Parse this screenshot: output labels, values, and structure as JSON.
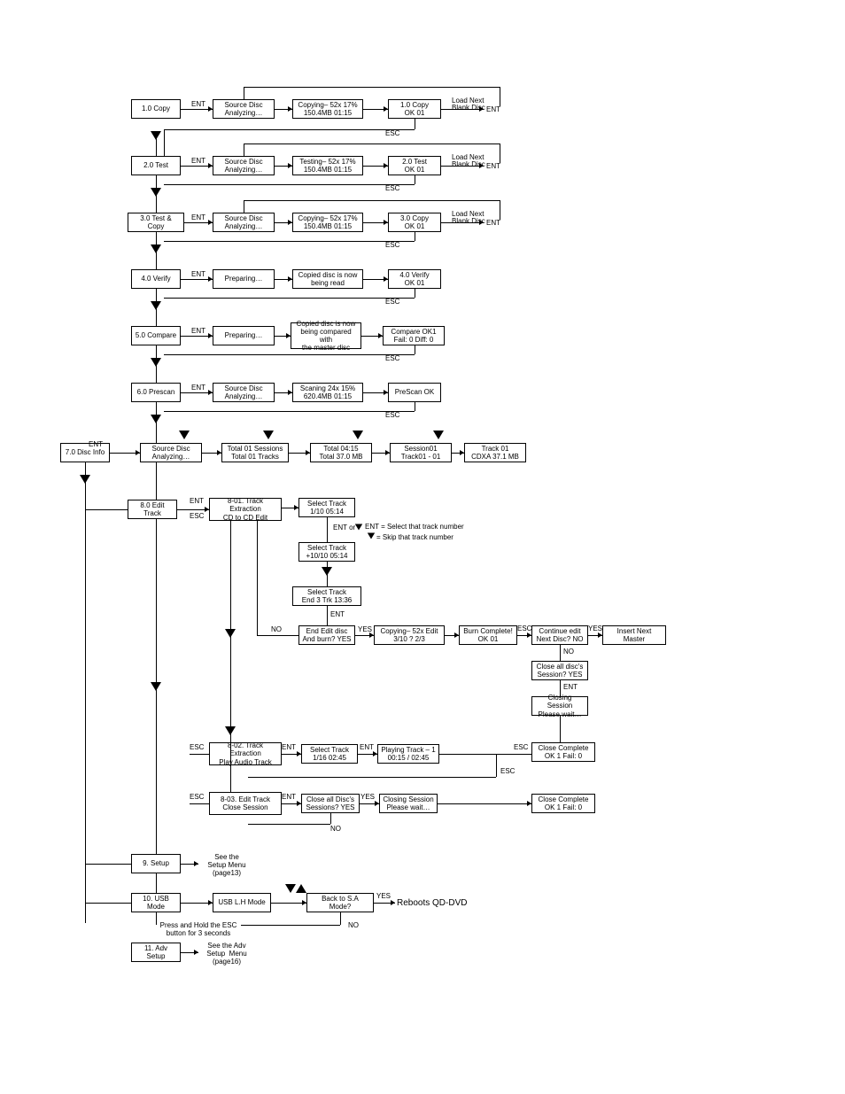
{
  "labels": {
    "ENT": "ENT",
    "ESC": "ESC",
    "NO": "NO",
    "YES": "YES",
    "ENTor": "ENT or",
    "loadNext1": "Load Next",
    "loadNext2": "Blank Disc"
  },
  "r1": {
    "a": "1.0 Copy",
    "b1": "Source Disc",
    "b2": "Analyzing…",
    "c1": "Copying– 52x    17%",
    "c2": "150.4MB         01:15",
    "d1": "1.0 Copy",
    "d2": "OK  01"
  },
  "r2": {
    "a": "2.0 Test",
    "b1": "Source Disc",
    "b2": "Analyzing…",
    "c1": "Testing– 52x    17%",
    "c2": "150.4MB         01:15",
    "d1": "2.0 Test",
    "d2": "OK  01"
  },
  "r3": {
    "a": "3.0 Test & Copy",
    "b1": "Source Disc",
    "b2": "Analyzing…",
    "c1": "Copying– 52x    17%",
    "c2": "150.4MB         01:15",
    "d1": "3.0 Copy",
    "d2": "OK  01"
  },
  "r4": {
    "a": "4.0 Verify",
    "b1": "Preparing…",
    "c1": "Copied disc is now",
    "c2": "being read",
    "d1": "4.0 Verify",
    "d2": "OK  01"
  },
  "r5": {
    "a": "5.0 Compare",
    "b1": "Preparing…",
    "c1": "Copied disc is now",
    "c2": "being compared with",
    "c3": "the master disc",
    "d1": "Compare      OK1",
    "d2": "Fail: 0        Diff: 0"
  },
  "r6": {
    "a": "6.0 Prescan",
    "b1": "Source Disc",
    "b2": "Analyzing…",
    "c1": "Scaning  24x    15%",
    "c2": "620.4MB         01:15",
    "d1": "PreScan OK"
  },
  "r7": {
    "a": "7.0 Disc Info",
    "b1": "Source Disc",
    "b2": "Analyzing…",
    "c1": "Total 01 Sessions",
    "c2": "Total 01 Tracks",
    "d1": "Total 04:15",
    "d2": "Total 37.0 MB",
    "e1": "Session01",
    "e2": "Track01 - 01",
    "f1": "Track 01",
    "f2": "CDXA 37.1 MB"
  },
  "r8": {
    "a": "8.0 Edit Track",
    "s1a": "8-01. Track Extraction",
    "s1b": "CD to CD Edit",
    "sel1a": "Select Track",
    "sel1b": "1/10      05:14",
    "sel2a": "Select Track",
    "sel2b": "+10/10      05:14",
    "sel3a": "Select Track",
    "sel3b": "End   3 Trk  13:36",
    "end1": "End Edit disc",
    "end2": "And burn?  YES",
    "copyEdit1": "Copying– 52x   Edit",
    "copyEdit2": "3/10  ?   2/3",
    "burn1": "Burn Complete!",
    "burn2": "OK  01",
    "cont1": "Continue edit",
    "cont2": "Next Disc?  NO",
    "insertNext": "Insert Next Master",
    "closeAll1": "Close all disc's",
    "closeAll2": "Session? YES",
    "closing1": "Closing Session",
    "closing2": "Please wait…",
    "closeComp1": "Close Complete",
    "closeComp2": "OK  1    Fail:  0",
    "s2a": "8-02. Track Extraction",
    "s2b": "Play Audio Track",
    "s2sel1": "Select Track",
    "s2sel2": "1/16   02:45",
    "s2play1": "Playing Track – 1",
    "s2play2": "00:15   /   02:45",
    "s3a": "8-03. Edit Track",
    "s3b": "Close Session",
    "s3close1": "Close all Disc's",
    "s3close2": "Sessions?   YES",
    "s3closing1": "Closing Session",
    "s3closing2": "Please wait…",
    "s3done1": "Close Complete",
    "s3done2": "OK  1    Fail:  0",
    "note1": "ENT = Select that track number",
    "note2": "= Skip that track number"
  },
  "r9": {
    "a": "9. Setup",
    "note": "See the\nSetup Menu\n(page13)"
  },
  "r10": {
    "a": "10. USB Mode",
    "b": "USB L.H Mode",
    "c": "Back to S.A Mode?",
    "reboot": "Reboots QD-DVD"
  },
  "r11": {
    "a": "11. Adv Setup",
    "noteTop": "Press and Hold the ESC\nbutton for 3 seconds",
    "note": "See the Adv\nSetup  Menu\n(page16)"
  }
}
